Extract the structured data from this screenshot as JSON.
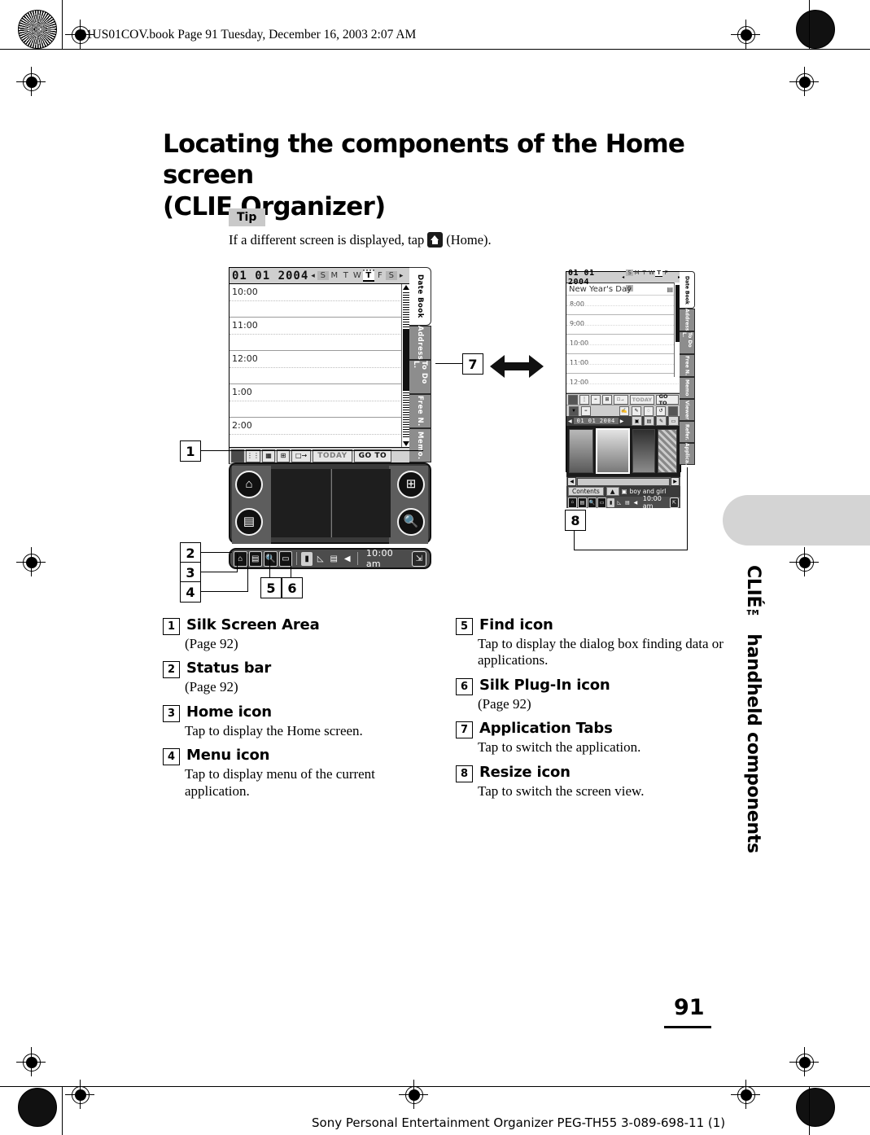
{
  "header": {
    "file_line": "01US01COV.book  Page 91  Tuesday, December 16, 2003  2:07 AM"
  },
  "title": {
    "line1": "Locating the components of the Home screen",
    "line2": "(CLIE Organizer)"
  },
  "tip": {
    "label": "Tip",
    "text_before": "If a different screen is displayed, tap",
    "text_after": "(Home)."
  },
  "screen_left": {
    "date": "01 01 2004",
    "prev_arrow": "◂",
    "next_arrow": "▸",
    "weekdays": [
      "S",
      "M",
      "T",
      "W",
      "T",
      "F",
      "S"
    ],
    "selected_weekday_index": 4,
    "time_slots": [
      "10:00",
      "11:00",
      "12:00",
      "1:00",
      "2:00"
    ],
    "toolbar_buttons": [
      "TODAY",
      "GO TO"
    ],
    "tabs": [
      "Date Book",
      "Address",
      "To Do L.",
      "Free N.",
      "Memo."
    ],
    "active_tab": "Date Book",
    "silk_icons": [
      "home-icon",
      "menu-icon",
      "calc-icon",
      "find-icon"
    ],
    "status_time": "10:00 am",
    "status_icons": [
      "home-icon",
      "menu-icon",
      "find-icon",
      "silk-plugin-icon",
      "battery-icon",
      "brightness-icon",
      "card-icon",
      "volume-icon"
    ],
    "resize_icon": "resize-icon"
  },
  "screen_right": {
    "date": "01 01 2004",
    "prev_arrow": "◂",
    "next_arrow": "▸",
    "weekdays": [
      "S",
      "M",
      "T",
      "W",
      "T",
      "F",
      "S"
    ],
    "selected_weekday_index": 4,
    "event_title": "New Year's Day",
    "time_slots": [
      "8:00",
      "9:00",
      "10:00",
      "11:00",
      "12:00"
    ],
    "toolbar_buttons": [
      "TODAY",
      "GO TO"
    ],
    "nav_date": "01 01 2004",
    "contents_label": "Contents",
    "photo_caption": "boy and girl",
    "tabs": [
      "Date Book",
      "Address",
      "To Do L.",
      "Free N.",
      "Memo",
      "Viewer",
      "Refer.",
      "Applica."
    ],
    "active_tab": "Date Book",
    "status_time": "10:00 am",
    "resize_icon": "resize-icon"
  },
  "callouts": [
    "1",
    "2",
    "3",
    "4",
    "5",
    "6",
    "7",
    "8"
  ],
  "legend": {
    "left_column": [
      {
        "num": "1",
        "title": "Silk Screen Area",
        "desc": "(Page 92)"
      },
      {
        "num": "2",
        "title": "Status bar",
        "desc": "(Page 92)"
      },
      {
        "num": "3",
        "title": "Home icon",
        "desc": "Tap to display the Home screen."
      },
      {
        "num": "4",
        "title": "Menu icon",
        "desc": "Tap to display menu of the current application."
      }
    ],
    "right_column": [
      {
        "num": "5",
        "title": "Find icon",
        "desc": "Tap to display the dialog box finding data or applications."
      },
      {
        "num": "6",
        "title": "Silk Plug-In icon",
        "desc": "(Page 92)"
      },
      {
        "num": "7",
        "title": "Application Tabs",
        "desc": "Tap to switch the application."
      },
      {
        "num": "8",
        "title": "Resize icon",
        "desc": "Tap to switch the screen view."
      }
    ]
  },
  "side_tab": {
    "label": "CLIÉ™ handheld components"
  },
  "page_number": "91",
  "footer": {
    "text": "Sony Personal Entertainment Organizer  PEG-TH55  3-089-698-11 (1)"
  }
}
